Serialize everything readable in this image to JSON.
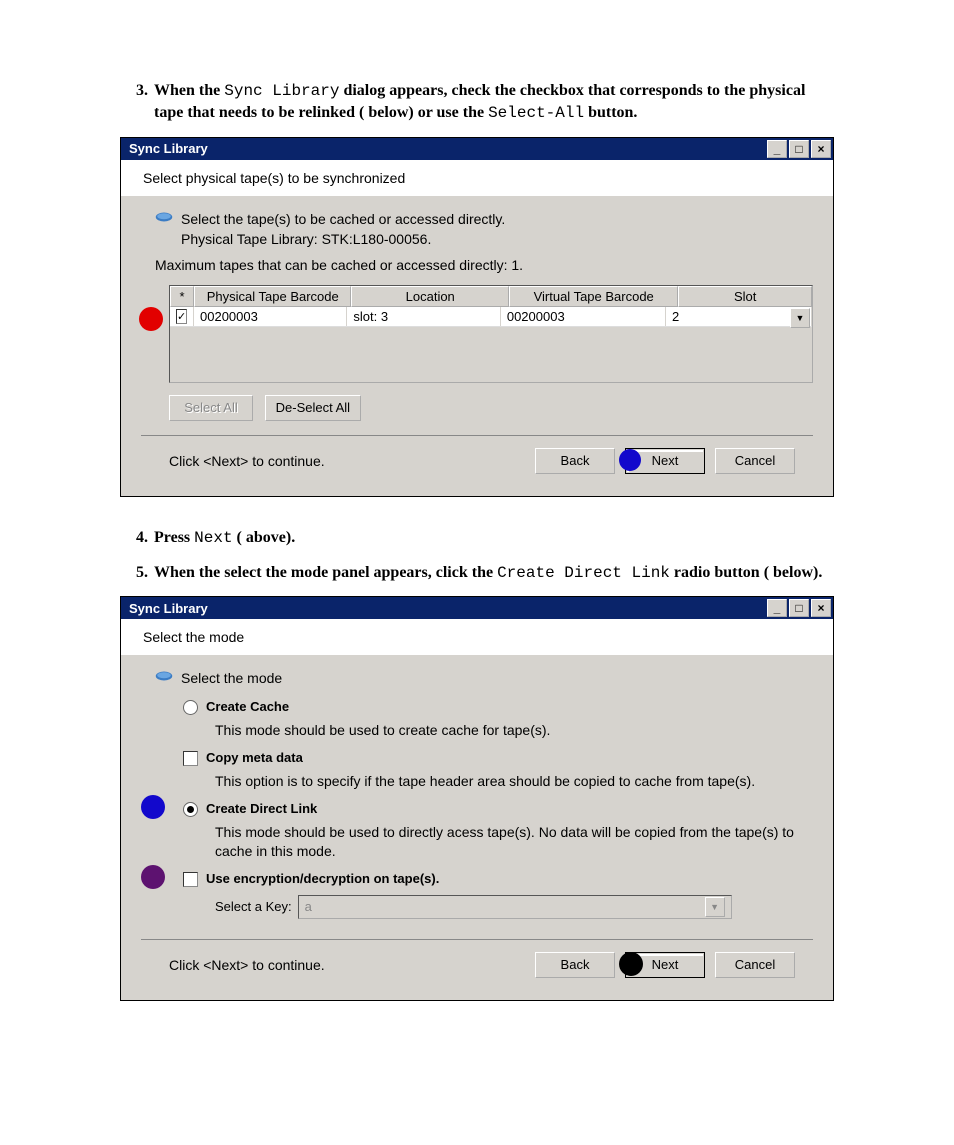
{
  "steps": {
    "s3_num": "3.",
    "s3_a": "When the ",
    "s3_code1": "Sync Library",
    "s3_b": " dialog appears, check the checkbox that corresponds to the physical tape that needs to be relinked (   below) or use the ",
    "s3_code2": "Select-All",
    "s3_c": " button.",
    "s4_num": "4.",
    "s4_a": "Press ",
    "s4_code1": "Next",
    "s4_b": " (   above).",
    "s5_num": "5.",
    "s5_a": "When the select the mode panel appears, click the ",
    "s5_code1": "Create Direct Link",
    "s5_b": " radio button (   below)."
  },
  "dialog1": {
    "title": "Sync Library",
    "subhead": "Select physical tape(s) to be synchronized",
    "hint": "Select the tape(s) to be cached or accessed directly.",
    "libline": "Physical Tape Library: STK:L180-00056.",
    "maxline": "Maximum tapes that can be cached or accessed directly: 1.",
    "cols": {
      "star": "*",
      "c1": "Physical Tape Barcode",
      "c2": "Location",
      "c3": "Virtual Tape Barcode",
      "c4": "Slot"
    },
    "row": {
      "check": "✓",
      "barcode": "00200003",
      "location": "slot:  3",
      "vbarcode": "00200003",
      "slot": "2"
    },
    "select_all": "Select All",
    "deselect_all": "De-Select All",
    "footer_hint": "Click <Next> to continue.",
    "back": "Back",
    "next": "Next",
    "cancel": "Cancel"
  },
  "dialog2": {
    "title": "Sync Library",
    "subhead": "Select the mode",
    "hint": "Select the mode",
    "opt1_title": "Create Cache",
    "opt1_desc": "This mode should be used to create cache for tape(s).",
    "copy_meta": "Copy meta data",
    "copy_meta_desc": "This option is to specify if the tape header area should be copied to cache from tape(s).",
    "opt2_title": "Create Direct Link",
    "opt2_desc": "This mode should be used to directly acess tape(s). No data will be copied from the tape(s) to cache in this mode.",
    "enc_title": "Use encryption/decryption on tape(s).",
    "key_label": "Select a Key:",
    "key_value": "a",
    "footer_hint": "Click <Next> to continue.",
    "back": "Back",
    "next": "Next",
    "cancel": "Cancel"
  }
}
